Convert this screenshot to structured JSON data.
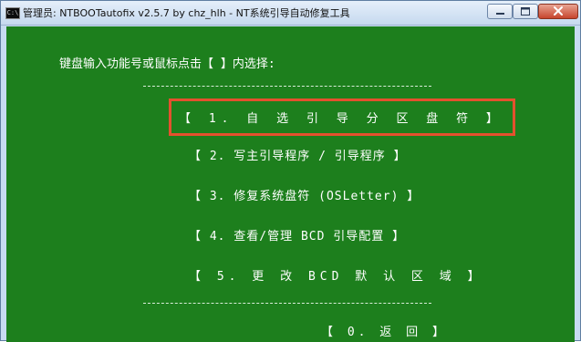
{
  "window": {
    "icon_text": "C:\\",
    "title": "管理员: NTBOOTautofix v2.5.7 by chz_hlh - NT系统引导自动修复工具"
  },
  "console": {
    "prompt": "键盘输入功能号或鼠标点击【 】内选择:",
    "menu": [
      "【 1. 自 选 引 导 分 区 盘 符 】",
      "【 2. 写主引导程序 / 引导程序 】",
      "【 3. 修复系统盘符 (OSLetter) 】",
      "【 4. 查看/管理 BCD 引导配置  】",
      "【 5. 更 改 BCD 默 认 区 域  】",
      "【 0. 返 回 】"
    ]
  },
  "colors": {
    "console_bg": "#1d7f1d",
    "selection_border": "#e4512e",
    "text": "#ffffff"
  },
  "icons": [
    "console-app-icon",
    "minimize-icon",
    "maximize-icon",
    "close-icon"
  ]
}
